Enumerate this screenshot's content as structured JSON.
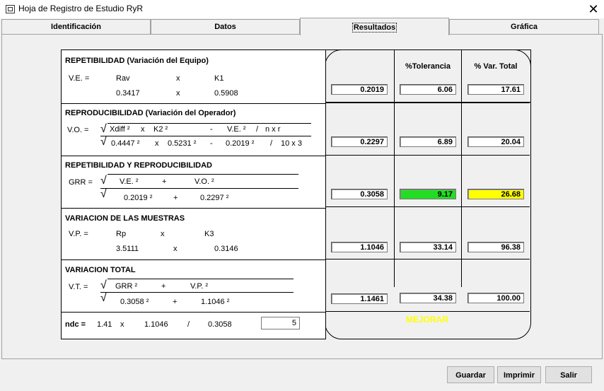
{
  "window": {
    "title": "Hoja de Registro de Estudio RyR",
    "close_glyph": "✕"
  },
  "tabs": [
    "Identificación",
    "Datos",
    "Resultados",
    "Gráfica"
  ],
  "columns": {
    "tolerance": "%Tolerancia",
    "var_total": "% Var. Total"
  },
  "ev": {
    "title": "REPETIBILIDAD (Variación del Equipo)",
    "lhs": "V.E.  =",
    "f1": "Rav",
    "op": "x",
    "f2": "K1",
    "v1": "0.3417",
    "v2": "0.5908",
    "value": "0.2019",
    "tol": "6.06",
    "pct": "17.61"
  },
  "av": {
    "title": "REPRODUCIBILIDAD (Variación del Operador)",
    "lhs": "V.O.  =",
    "formula": [
      "Xdiff ²",
      "x",
      "K2 ²",
      "-",
      "V.E. ²",
      "/",
      "n x r"
    ],
    "values": [
      "0.4447 ²",
      "x",
      "0.5231 ²",
      "-",
      "0.2019 ²",
      "/",
      "10 x 3"
    ],
    "value": "0.2297",
    "tol": "6.89",
    "pct": "20.04"
  },
  "grr": {
    "title": "REPETIBILIDAD Y REPRODUCIBILIDAD",
    "lhs": "GRR  =",
    "formula": [
      "V.E. ²",
      "+",
      "V.O. ²"
    ],
    "values": [
      "0.2019 ²",
      "+",
      "0.2297 ²"
    ],
    "value": "0.3058",
    "tol": "9.17",
    "pct": "26.68",
    "tol_color": "#22dd22",
    "pct_color": "#ffff00"
  },
  "pv": {
    "title": "VARIACION DE LAS MUESTRAS",
    "lhs": "V.P.  =",
    "f1": "Rp",
    "op": "x",
    "f2": "K3",
    "v1": "3.5111",
    "v2": "0.3146",
    "value": "1.1046",
    "tol": "33.14",
    "pct": "96.38"
  },
  "tv": {
    "title": "VARIACION TOTAL",
    "lhs": "V.T.  =",
    "formula": [
      "GRR ²",
      "+",
      "V.P. ²"
    ],
    "values": [
      "0.3058 ²",
      "+",
      "1.1046 ²"
    ],
    "value": "1.1461",
    "tol": "34.38",
    "pct": "100.00"
  },
  "ndc": {
    "label": "ndc =",
    "a": "1.41",
    "x": "x",
    "b": "1.1046",
    "slash": "/",
    "c": "0.3058",
    "result": "5"
  },
  "verdict": "MEJORAR",
  "buttons": {
    "save": "Guardar",
    "print": "Imprimir",
    "exit": "Salir"
  }
}
